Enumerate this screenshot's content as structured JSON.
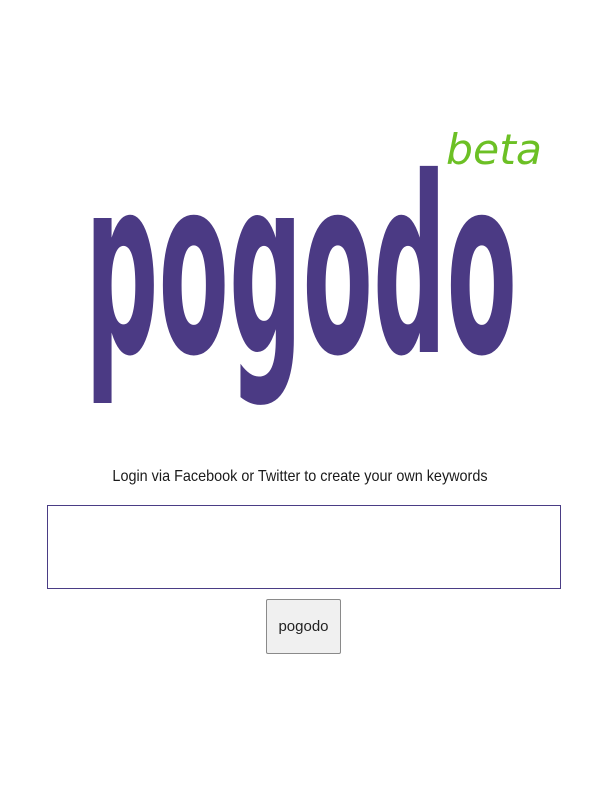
{
  "logo": {
    "wordmark": "pogodo",
    "badge": "beta",
    "wordmark_color": "#4b3a84",
    "badge_color": "#6cc025"
  },
  "login": {
    "prompt": "Login via Facebook or Twitter to create your own keywords"
  },
  "search": {
    "value": "",
    "submit_label": "pogodo"
  },
  "colors": {
    "input_border": "#4a3d85",
    "background": "#ffffff"
  }
}
